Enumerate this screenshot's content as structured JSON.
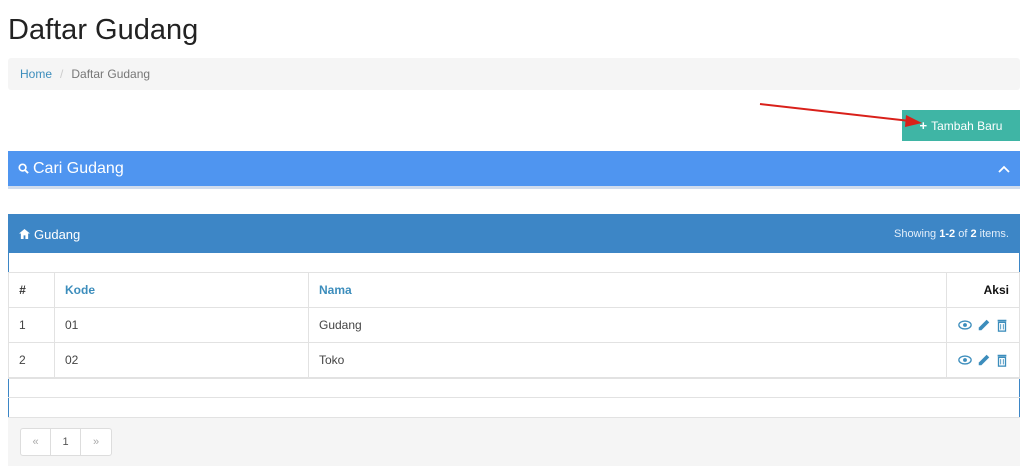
{
  "page": {
    "title": "Daftar Gudang"
  },
  "breadcrumb": {
    "home": "Home",
    "separator": "/",
    "current": "Daftar Gudang"
  },
  "toolbar": {
    "add_label": "Tambah Baru"
  },
  "search_panel": {
    "title": "Cari Gudang",
    "icon": "search-icon",
    "collapse_icon": "chevron-up-icon"
  },
  "grid": {
    "title": "Gudang",
    "icon": "home-icon",
    "summary": {
      "prefix": "Showing",
      "range": "1-2",
      "of": "of",
      "total": "2",
      "suffix": "items."
    },
    "columns": {
      "num": "#",
      "kode": "Kode",
      "nama": "Nama",
      "aksi": "Aksi"
    },
    "rows": [
      {
        "num": "1",
        "kode": "01",
        "nama": "Gudang"
      },
      {
        "num": "2",
        "kode": "02",
        "nama": "Toko"
      }
    ],
    "actions": [
      "view-icon",
      "edit-icon",
      "delete-icon"
    ],
    "pagination": {
      "prev": "«",
      "page": "1",
      "next": "»"
    }
  },
  "colors": {
    "primary_panel": "#4f95f0",
    "grid_header": "#3d86c6",
    "add_button": "#3fb5a5",
    "arrow": "#d9201a",
    "link": "#3c8dbc"
  }
}
